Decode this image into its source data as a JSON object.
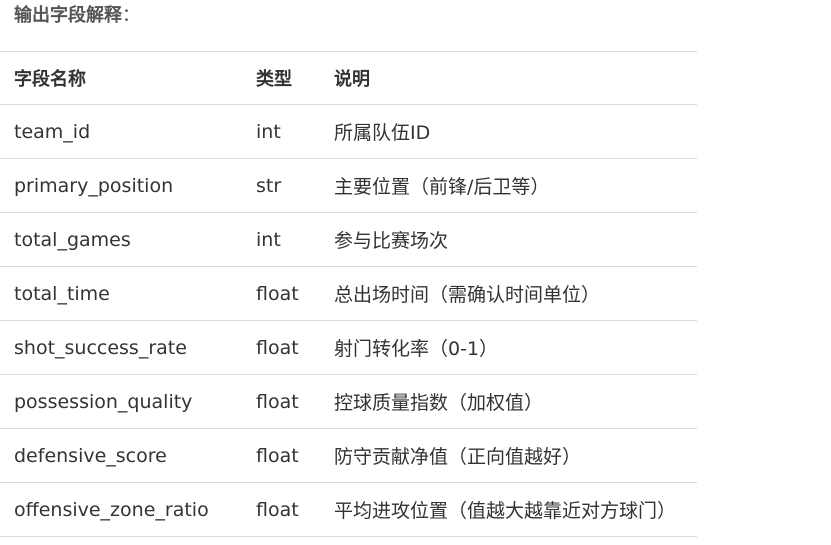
{
  "section": {
    "title": "输出字段解释",
    "colon": "："
  },
  "table": {
    "headers": [
      "字段名称",
      "类型",
      "说明"
    ],
    "rows": [
      [
        "team_id",
        "int",
        "所属队伍ID"
      ],
      [
        "primary_position",
        "str",
        "主要位置（前锋/后卫等）"
      ],
      [
        "total_games",
        "int",
        "参与比赛场次"
      ],
      [
        "total_time",
        "float",
        "总出场时间（需确认时间单位）"
      ],
      [
        "shot_success_rate",
        "float",
        "射门转化率（0-1）"
      ],
      [
        "possession_quality",
        "float",
        "控球质量指数（加权值）"
      ],
      [
        "defensive_score",
        "float",
        "防守贡献净值（正向值越好）"
      ],
      [
        "offensive_zone_ratio",
        "float",
        "平均进攻位置（值越大越靠近对方球门）"
      ]
    ]
  }
}
